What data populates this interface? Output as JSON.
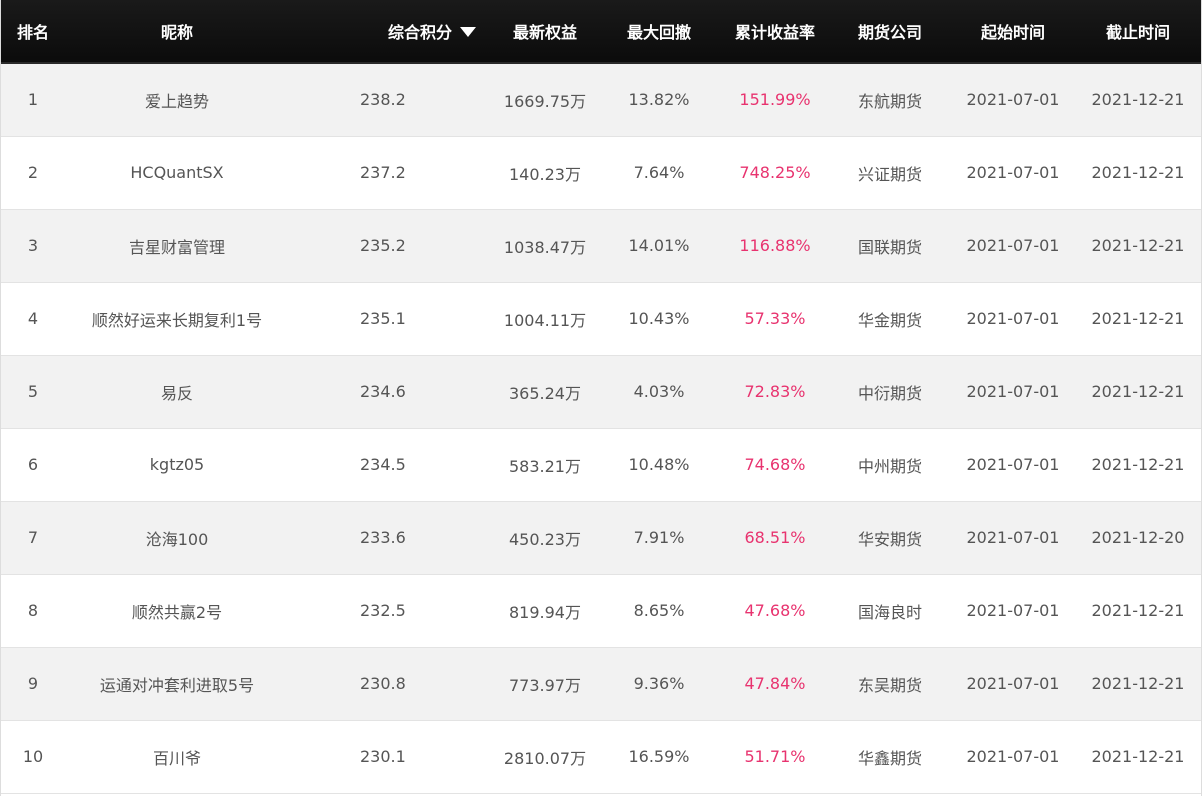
{
  "header": {
    "rank": "排名",
    "nickname": "昵称",
    "score": "综合积分",
    "equity": "最新权益",
    "drawdown": "最大回撤",
    "return_rate": "累计收益率",
    "company": "期货公司",
    "start": "起始时间",
    "end": "截止时间"
  },
  "sort": {
    "column": "score",
    "direction": "desc",
    "icon": "caret-down-icon"
  },
  "colors": {
    "header_bg": "#111111",
    "rate": "#e8336f",
    "text": "#555555",
    "row_alt": "#f2f2f2"
  },
  "rows": [
    {
      "rank": "1",
      "nickname": "爱上趋势",
      "score": "238.2",
      "equity": "1669.75万",
      "drawdown": "13.82%",
      "return_rate": "151.99%",
      "company": "东航期货",
      "start": "2021-07-01",
      "end": "2021-12-21"
    },
    {
      "rank": "2",
      "nickname": "HCQuantSX",
      "score": "237.2",
      "equity": "140.23万",
      "drawdown": "7.64%",
      "return_rate": "748.25%",
      "company": "兴证期货",
      "start": "2021-07-01",
      "end": "2021-12-21"
    },
    {
      "rank": "3",
      "nickname": "吉星财富管理",
      "score": "235.2",
      "equity": "1038.47万",
      "drawdown": "14.01%",
      "return_rate": "116.88%",
      "company": "国联期货",
      "start": "2021-07-01",
      "end": "2021-12-21"
    },
    {
      "rank": "4",
      "nickname": "顺然好运来长期复利1号",
      "score": "235.1",
      "equity": "1004.11万",
      "drawdown": "10.43%",
      "return_rate": "57.33%",
      "company": "华金期货",
      "start": "2021-07-01",
      "end": "2021-12-21"
    },
    {
      "rank": "5",
      "nickname": "易反",
      "score": "234.6",
      "equity": "365.24万",
      "drawdown": "4.03%",
      "return_rate": "72.83%",
      "company": "中衍期货",
      "start": "2021-07-01",
      "end": "2021-12-21"
    },
    {
      "rank": "6",
      "nickname": "kgtz05",
      "score": "234.5",
      "equity": "583.21万",
      "drawdown": "10.48%",
      "return_rate": "74.68%",
      "company": "中州期货",
      "start": "2021-07-01",
      "end": "2021-12-21"
    },
    {
      "rank": "7",
      "nickname": "沧海100",
      "score": "233.6",
      "equity": "450.23万",
      "drawdown": "7.91%",
      "return_rate": "68.51%",
      "company": "华安期货",
      "start": "2021-07-01",
      "end": "2021-12-20"
    },
    {
      "rank": "8",
      "nickname": "顺然共赢2号",
      "score": "232.5",
      "equity": "819.94万",
      "drawdown": "8.65%",
      "return_rate": "47.68%",
      "company": "国海良时",
      "start": "2021-07-01",
      "end": "2021-12-21"
    },
    {
      "rank": "9",
      "nickname": "运通对冲套利进取5号",
      "score": "230.8",
      "equity": "773.97万",
      "drawdown": "9.36%",
      "return_rate": "47.84%",
      "company": "东吴期货",
      "start": "2021-07-01",
      "end": "2021-12-21"
    },
    {
      "rank": "10",
      "nickname": "百川爷",
      "score": "230.1",
      "equity": "2810.07万",
      "drawdown": "16.59%",
      "return_rate": "51.71%",
      "company": "华鑫期货",
      "start": "2021-07-01",
      "end": "2021-12-21"
    }
  ]
}
